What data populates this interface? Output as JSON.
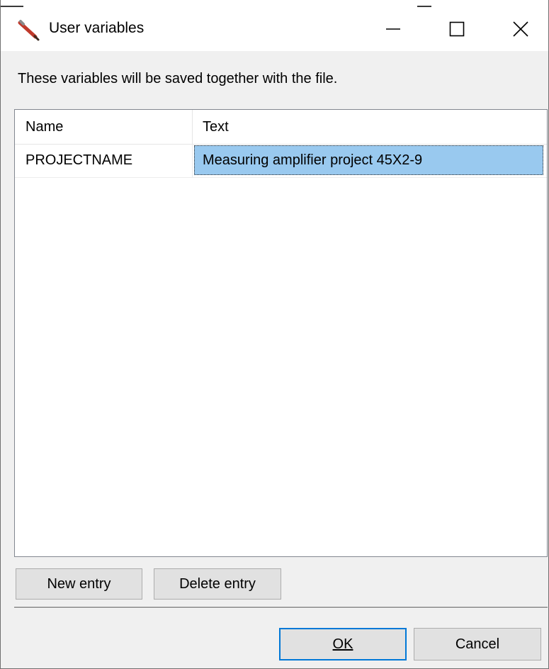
{
  "window": {
    "title": "User variables",
    "minimize_icon": "minimize-icon",
    "maximize_icon": "maximize-icon",
    "close_icon": "close-icon",
    "app_icon": "pencil-icon"
  },
  "description": "These variables will be saved together with the file.",
  "grid": {
    "columns": [
      "Name",
      "Text"
    ],
    "rows": [
      {
        "name": "PROJECTNAME",
        "text": "Measuring amplifier project 45X2-9",
        "selected": true
      }
    ]
  },
  "buttons": {
    "new_entry": "New entry",
    "delete_entry": "Delete entry",
    "ok": "OK",
    "cancel": "Cancel"
  },
  "colors": {
    "selection": "#99c9ef",
    "default_button_border": "#0078d7",
    "button_bg": "#e1e1e1"
  }
}
